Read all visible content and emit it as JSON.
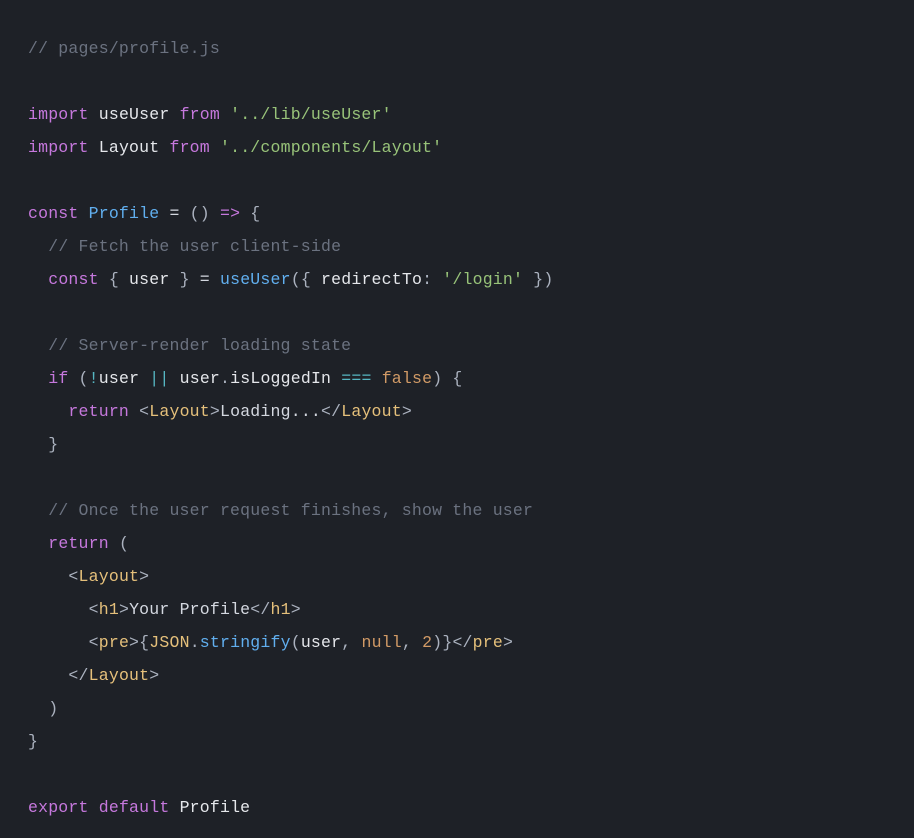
{
  "code": {
    "line1_comment": "// pages/profile.js",
    "line3_import": "import",
    "line3_useUser": "useUser",
    "line3_from": "from",
    "line3_path": "'../lib/useUser'",
    "line4_import": "import",
    "line4_Layout": "Layout",
    "line4_from": "from",
    "line4_path": "'../components/Layout'",
    "line6_const": "const",
    "line6_Profile": "Profile",
    "line6_eq": " = ",
    "line6_parens": "()",
    "line6_arrow": " => ",
    "line6_brace": "{",
    "line7_comment": "// Fetch the user client-side",
    "line8_const": "const",
    "line8_lbrace": " { ",
    "line8_user": "user",
    "line8_rbrace": " } ",
    "line8_eq": "= ",
    "line8_useUser": "useUser",
    "line8_lparen": "({ ",
    "line8_redirectTo": "redirectTo",
    "line8_colon": ": ",
    "line8_login": "'/login'",
    "line8_rparen": " })",
    "line10_comment": "// Server-render loading state",
    "line11_if": "if",
    "line11_cond_open": " (",
    "line11_not": "!",
    "line11_user1": "user",
    "line11_or": " || ",
    "line11_user2": "user",
    "line11_dot": ".",
    "line11_isLoggedIn": "isLoggedIn",
    "line11_eqeq": " === ",
    "line11_false": "false",
    "line11_cond_close": ") {",
    "line12_return": "return",
    "line12_sp": " ",
    "line12_open_angle": "<",
    "line12_Layout1": "Layout",
    "line12_close_angle": ">",
    "line12_text": "Loading...",
    "line12_open_angle2": "</",
    "line12_Layout2": "Layout",
    "line12_close_angle2": ">",
    "line13_brace": "}",
    "line15_comment": "// Once the user request finishes, show the user",
    "line16_return": "return",
    "line16_paren": " (",
    "line17_open": "<",
    "line17_Layout": "Layout",
    "line17_close": ">",
    "line18_open": "<",
    "line18_h1": "h1",
    "line18_close": ">",
    "line18_text": "Your Profile",
    "line18_open2": "</",
    "line18_h1b": "h1",
    "line18_close2": ">",
    "line19_open": "<",
    "line19_pre": "pre",
    "line19_close": ">",
    "line19_lbrace": "{",
    "line19_JSON": "JSON",
    "line19_dot": ".",
    "line19_stringify": "stringify",
    "line19_lparen": "(",
    "line19_user": "user",
    "line19_c1": ", ",
    "line19_null": "null",
    "line19_c2": ", ",
    "line19_two": "2",
    "line19_rparen": ")",
    "line19_rbrace": "}",
    "line19_open2": "</",
    "line19_preb": "pre",
    "line19_close2": ">",
    "line20_open": "</",
    "line20_Layout": "Layout",
    "line20_close": ">",
    "line21_paren": ")",
    "line22_brace": "}",
    "line24_export": "export",
    "line24_default": "default",
    "line24_Profile": "Profile"
  }
}
